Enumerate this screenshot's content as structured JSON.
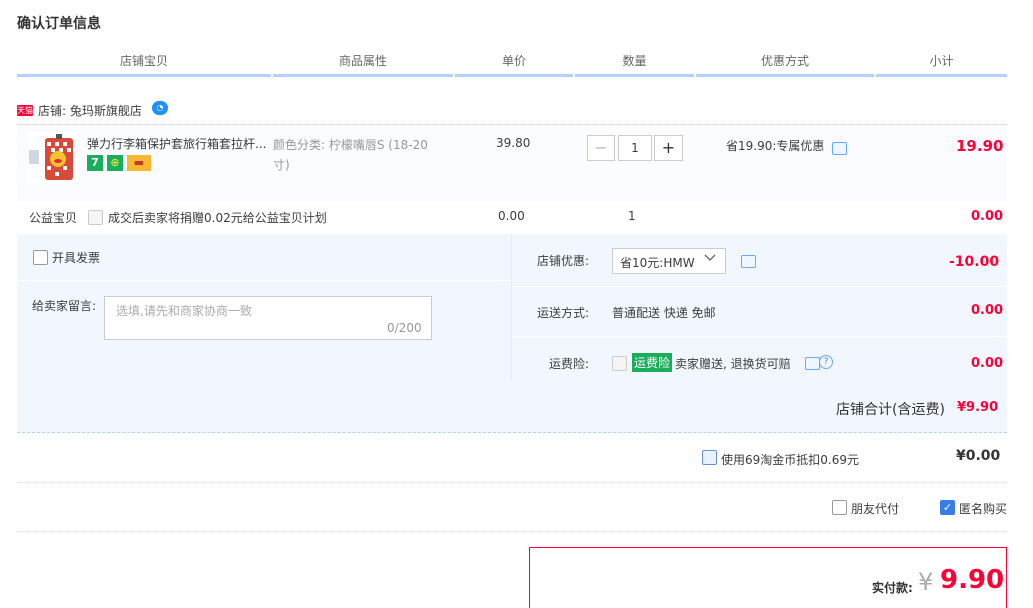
{
  "page_title": "确认订单信息",
  "columns": [
    "店铺宝贝",
    "商品属性",
    "单价",
    "数量",
    "优惠方式",
    "小计"
  ],
  "shop": {
    "badge": "天猫",
    "label": "店铺: 兔玛斯旗舰店"
  },
  "item": {
    "title": "弹力行李箱保护套旅行箱套拉杆...",
    "attr_line1": "颜色分类: 柠檬嘴唇S (18-20",
    "attr_line2": "寸)",
    "price": "39.80",
    "qty": "1",
    "minus": "−",
    "plus": "+",
    "promo": "省19.90:专属优惠",
    "subtotal": "19.90",
    "badges": [
      "7",
      "⊕",
      "▬"
    ]
  },
  "charity": {
    "label": "公益宝贝",
    "text": "成交后卖家将捐赠0.02元给公益宝贝计划",
    "price": "0.00",
    "qty": "1",
    "subtotal": "0.00"
  },
  "invoice": {
    "label": "开具发票"
  },
  "message": {
    "label": "给卖家留言:",
    "placeholder": "选填,请先和商家协商一致",
    "counter": "0/200"
  },
  "shop_discount": {
    "label": "店铺优惠:",
    "selected": "省10元:HMW",
    "value": "-10.00"
  },
  "shipping": {
    "label": "运送方式:",
    "text": "普通配送 快递 免邮",
    "value": "0.00"
  },
  "insurance": {
    "label": "运费险:",
    "tag": "运费险",
    "text": "卖家赠送, 退换货可赔",
    "value": "0.00"
  },
  "shop_total": {
    "label": "店铺合计(含运费)",
    "value": "¥9.90"
  },
  "coins": {
    "label": "使用69淘金币抵扣0.69元",
    "value": "¥0.00"
  },
  "friend_pay": {
    "label": "朋友代付"
  },
  "anonymous": {
    "label": "匿名购买"
  },
  "pay": {
    "label": "实付款:",
    "currency": "¥",
    "value": "9.90"
  },
  "colors": {
    "accent_red": "#ff0036",
    "header_line": "#b2d1ff"
  }
}
